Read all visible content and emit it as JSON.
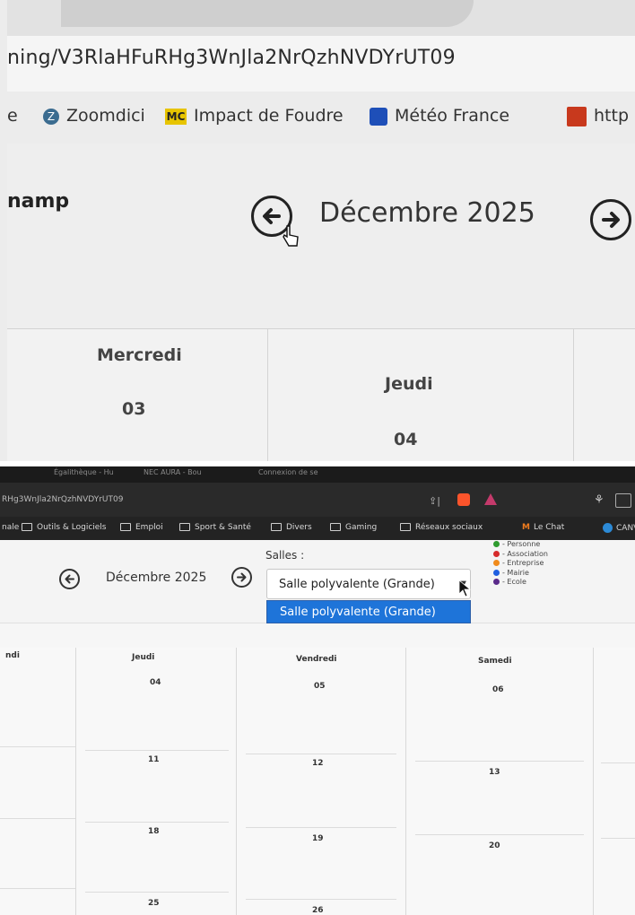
{
  "top": {
    "url": "ning/V3RlaHFuRHg3WnJla2NrQzhNVDYrUT09",
    "bookmarks": [
      {
        "label": "e",
        "icon": "bookmark-fragment"
      },
      {
        "label": "Zoomdici",
        "icon": "zoomdici-icon"
      },
      {
        "label": "Impact de Foudre",
        "icon": "mc-icon",
        "icon_text": "MC"
      },
      {
        "label": "Météo France",
        "icon": "meteo-france-icon"
      },
      {
        "label": "http",
        "icon": "http-icon"
      }
    ],
    "brand_fragment": "namp",
    "month_label": "Décembre 2025",
    "days": [
      {
        "name": "Mercredi",
        "number": "03"
      },
      {
        "name": "Jeudi",
        "number": "04"
      }
    ]
  },
  "bottom": {
    "tabs": [
      "Égalithèque - Hu",
      "NEC AURA - Bou",
      "Connexion de se"
    ],
    "url": "RHg3WnJla2NrQzhNVDYrUT09",
    "bookmarks": [
      "nale",
      "Outils & Logiciels",
      "Emploi",
      "Sport & Santé",
      "Divers",
      "Gaming",
      "Réseaux sociaux",
      "Le Chat",
      "CANV"
    ],
    "bookmark_lechat_icon": "M",
    "month_label": "Décembre 2025",
    "salles_label": "Salles :",
    "select_value": "Salle polyvalente (Grande)",
    "dropdown_options": [
      "Salle polyvalente (Grande)"
    ],
    "legend": [
      {
        "label": "- Personne",
        "color": "#2e9b2e"
      },
      {
        "label": "- Association",
        "color": "#d62b2b"
      },
      {
        "label": "- Entreprise",
        "color": "#f08a1c"
      },
      {
        "label": "- Mairie",
        "color": "#1f5fe0"
      },
      {
        "label": "- Ecole",
        "color": "#5a2a8a"
      }
    ],
    "columns": [
      {
        "name": "ndi",
        "numbers": []
      },
      {
        "name": "Jeudi",
        "numbers": [
          "04",
          "11",
          "18",
          "25"
        ]
      },
      {
        "name": "Vendredi",
        "numbers": [
          "05",
          "12",
          "19",
          "26"
        ]
      },
      {
        "name": "Samedi",
        "numbers": [
          "06",
          "13",
          "20"
        ]
      }
    ]
  }
}
